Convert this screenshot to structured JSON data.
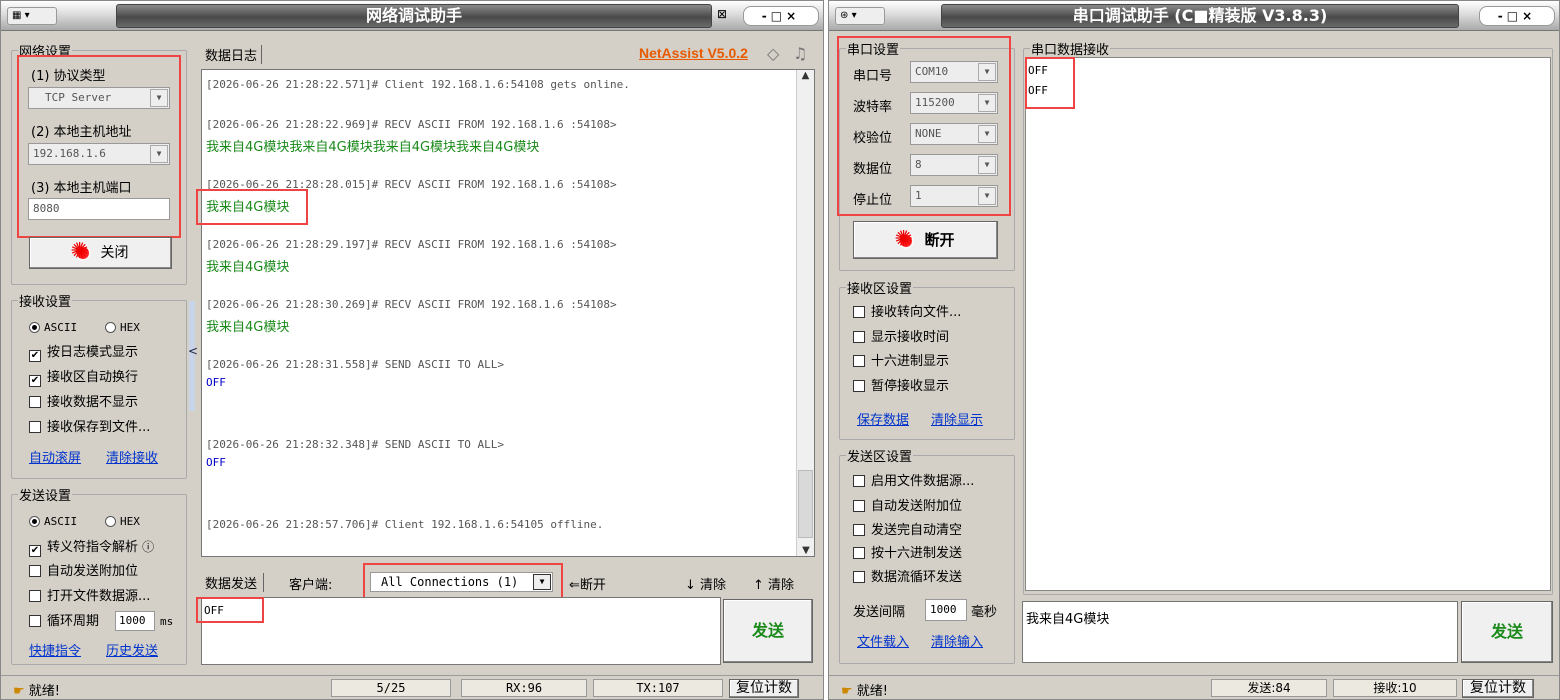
{
  "net": {
    "title": "网络调试助手",
    "brand": "NetAssist V5.0.2",
    "net_settings": "网络设置",
    "proto_label": "(1) 协议类型",
    "proto_value": "TCP Server",
    "host_label": "(2) 本地主机地址",
    "host_value": "192.168.1.6",
    "port_label": "(3) 本地主机端口",
    "port_value": "8080",
    "close_btn": "关闭",
    "recv_settings": "接收设置",
    "ascii": "ASCII",
    "hex": "HEX",
    "recv_opts": [
      "按日志模式显示",
      "接收区自动换行",
      "接收数据不显示",
      "接收保存到文件..."
    ],
    "recv_checked": [
      true,
      true,
      false,
      false
    ],
    "auto_scroll": "自动滚屏",
    "clear_recv": "清除接收",
    "send_settings": "发送设置",
    "send_opts": [
      "转义符指令解析",
      "自动发送附加位",
      "打开文件数据源...",
      "循环周期"
    ],
    "send_checked": [
      true,
      false,
      false,
      false
    ],
    "cycle_value": "1000",
    "cycle_unit": "ms",
    "quick_cmd": "快捷指令",
    "history_send": "历史发送",
    "log_tab": "数据日志",
    "log": [
      {
        "t": "[2026-06-26 21:28:22.571]# Client 192.168.1.6:54108 gets online.",
        "c": ""
      },
      {
        "t": "[2026-06-26 21:28:22.969]# RECV ASCII FROM 192.168.1.6 :54108>",
        "c": ""
      },
      {
        "t": "我来自4G模块我来自4G模块我来自4G模块我来自4G模块",
        "c": "g"
      },
      {
        "t": "[2026-06-26 21:28:28.015]# RECV ASCII FROM 192.168.1.6 :54108>",
        "c": ""
      },
      {
        "t": "我来自4G模块",
        "c": "g"
      },
      {
        "t": "[2026-06-26 21:28:29.197]# RECV ASCII FROM 192.168.1.6 :54108>",
        "c": ""
      },
      {
        "t": "我来自4G模块",
        "c": "g"
      },
      {
        "t": "[2026-06-26 21:28:30.269]# RECV ASCII FROM 192.168.1.6 :54108>",
        "c": ""
      },
      {
        "t": "我来自4G模块",
        "c": "g"
      },
      {
        "t": "[2026-06-26 21:28:31.558]# SEND ASCII TO ALL>",
        "c": ""
      },
      {
        "t": "OFF",
        "c": "b"
      },
      {
        "t": "[2026-06-26 21:28:32.348]# SEND ASCII TO ALL>",
        "c": ""
      },
      {
        "t": "OFF",
        "c": "b"
      },
      {
        "t": "[2026-06-26 21:28:57.706]# Client 192.168.1.6:54105 offline.",
        "c": ""
      }
    ],
    "send_tab": "数据发送",
    "client_label": "客户端:",
    "client_value": "All Connections (1)",
    "disconnect": "断开",
    "clear1": "清除",
    "clear2": "清除",
    "send_text": "OFF",
    "send_btn": "发送",
    "status_ready": "就绪!",
    "status_count": "5/25",
    "status_rx": "RX:96",
    "status_tx": "TX:107",
    "reset_count": "复位计数"
  },
  "ser": {
    "title": "串口调试助手 (C■精装版 V3.8.3)",
    "port_settings": "串口设置",
    "fields": [
      {
        "label": "串口号",
        "value": "COM10"
      },
      {
        "label": "波特率",
        "value": "115200"
      },
      {
        "label": "校验位",
        "value": "NONE"
      },
      {
        "label": "数据位",
        "value": "8"
      },
      {
        "label": "停止位",
        "value": "1"
      }
    ],
    "disconnect_btn": "断开",
    "recv_area_settings": "接收区设置",
    "recv_opts": [
      "接收转向文件...",
      "显示接收时间",
      "十六进制显示",
      "暂停接收显示"
    ],
    "save_data": "保存数据",
    "clear_display": "清除显示",
    "send_area_settings": "发送区设置",
    "send_opts": [
      "启用文件数据源...",
      "自动发送附加位",
      "发送完自动清空",
      "按十六进制发送",
      "数据流循环发送"
    ],
    "interval_label": "发送间隔",
    "interval_value": "1000",
    "interval_unit": "毫秒",
    "load_file": "文件载入",
    "clear_input": "清除输入",
    "recv_legend": "串口数据接收",
    "recv_lines": [
      "OFF",
      "OFF"
    ],
    "send_text": "我来自4G模块",
    "send_btn": "发送",
    "status_ready": "就绪!",
    "status_sent": "发送:84",
    "status_recv": "接收:10",
    "reset_count": "复位计数"
  },
  "colors": {
    "log_green": "#1a8a1a",
    "log_blue": "#0000cc",
    "highlight_red": "#e44444",
    "brand_orange": "#e85a00"
  }
}
